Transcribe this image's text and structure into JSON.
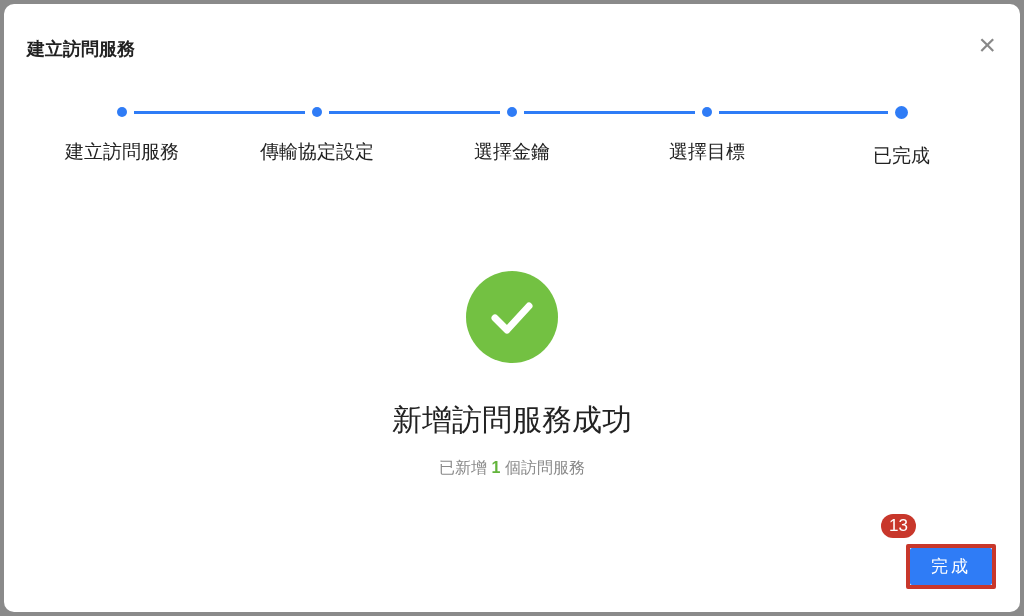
{
  "dialog": {
    "title": "建立訪問服務",
    "close": "×"
  },
  "steps": [
    {
      "label": "建立訪問服務",
      "done": true,
      "selected": false
    },
    {
      "label": "傳輸協定設定",
      "done": true,
      "selected": false
    },
    {
      "label": "選擇金鑰",
      "done": true,
      "selected": false
    },
    {
      "label": "選擇目標",
      "done": true,
      "selected": false
    },
    {
      "label": "已完成",
      "done": true,
      "selected": true
    }
  ],
  "result": {
    "heading": "新增訪問服務成功",
    "message_prefix": "已新增",
    "count": "1",
    "message_suffix": "個訪問服務"
  },
  "annotation": {
    "badge": "13"
  },
  "buttons": [
    {
      "label": "完成"
    }
  ]
}
